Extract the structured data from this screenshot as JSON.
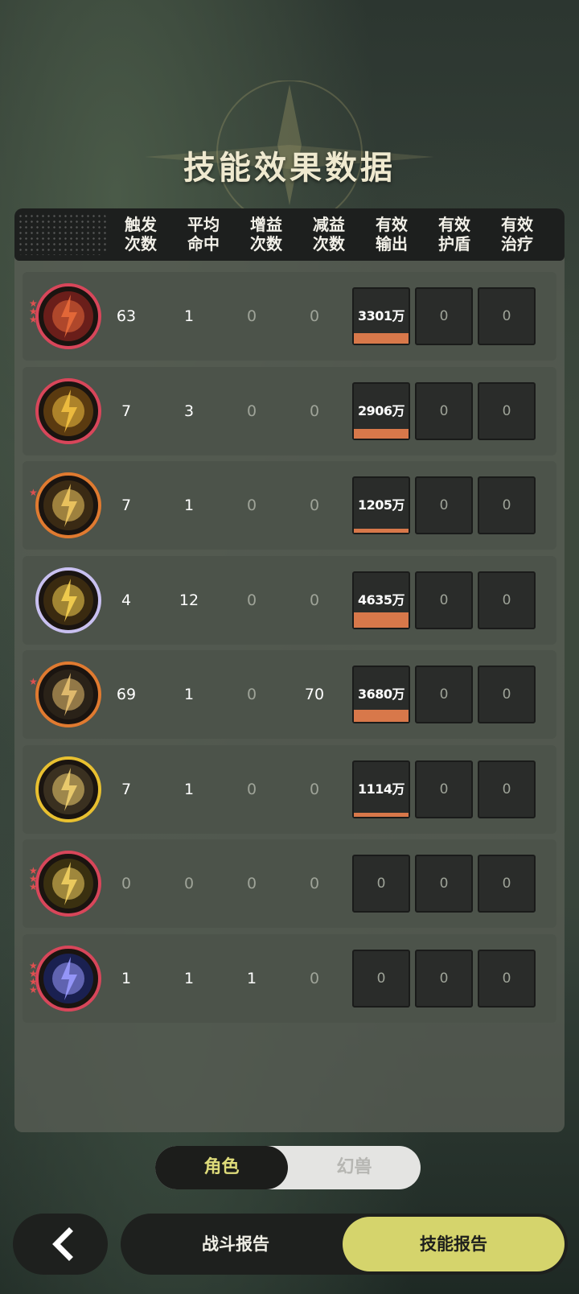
{
  "title": "技能效果数据",
  "columns": [
    {
      "line1": "触发",
      "line2": "次数"
    },
    {
      "line1": "平均",
      "line2": "命中"
    },
    {
      "line1": "增益",
      "line2": "次数"
    },
    {
      "line1": "减益",
      "line2": "次数"
    },
    {
      "line1": "有效",
      "line2": "输出"
    },
    {
      "line1": "有效",
      "line2": "护盾"
    },
    {
      "line1": "有效",
      "line2": "治疗"
    }
  ],
  "rows": [
    {
      "icon": "meteor-skill-icon",
      "stars": 3,
      "trigger": "63",
      "hits": "1",
      "buff": "0",
      "debuff": "0",
      "output": "3301万",
      "output_fraction": 0.71,
      "shield": "0",
      "heal": "0"
    },
    {
      "icon": "lightning-burst-skill-icon",
      "stars": 0,
      "trigger": "7",
      "hits": "3",
      "buff": "0",
      "debuff": "0",
      "output": "2906万",
      "output_fraction": 0.63,
      "shield": "0",
      "heal": "0"
    },
    {
      "icon": "chain-spark-skill-icon",
      "stars": 1,
      "trigger": "7",
      "hits": "1",
      "buff": "0",
      "debuff": "0",
      "output": "1205万",
      "output_fraction": 0.26,
      "shield": "0",
      "heal": "0"
    },
    {
      "icon": "thunder-orb-skill-icon",
      "stars": 0,
      "trigger": "4",
      "hits": "12",
      "buff": "0",
      "debuff": "0",
      "output": "4635万",
      "output_fraction": 1.0,
      "shield": "0",
      "heal": "0"
    },
    {
      "icon": "golden-ring-skill-icon",
      "stars": 1,
      "trigger": "69",
      "hits": "1",
      "buff": "0",
      "debuff": "70",
      "output": "3680万",
      "output_fraction": 0.79,
      "shield": "0",
      "heal": "0"
    },
    {
      "icon": "lightning-emblem-skill-icon",
      "stars": 0,
      "trigger": "7",
      "hits": "1",
      "buff": "0",
      "debuff": "0",
      "output": "1114万",
      "output_fraction": 0.24,
      "shield": "0",
      "heal": "0"
    },
    {
      "icon": "golden-figure-skill-icon",
      "stars": 3,
      "trigger": "0",
      "hits": "0",
      "buff": "0",
      "debuff": "0",
      "output": "0",
      "output_fraction": 0,
      "shield": "0",
      "heal": "0"
    },
    {
      "icon": "arcane-clock-skill-icon",
      "stars": 4,
      "trigger": "1",
      "hits": "1",
      "buff": "1",
      "debuff": "0",
      "output": "0",
      "output_fraction": 0,
      "shield": "0",
      "heal": "0"
    }
  ],
  "toggle": {
    "active": "角色",
    "inactive": "幻兽"
  },
  "nav": {
    "back_icon": "chevron-left-icon",
    "tab_battle": "战斗报告",
    "tab_skill": "技能报告"
  },
  "colors": {
    "accent": "#d5d46c",
    "output_bar": "#d8784a",
    "toggle_active_text": "#dedb7a"
  }
}
